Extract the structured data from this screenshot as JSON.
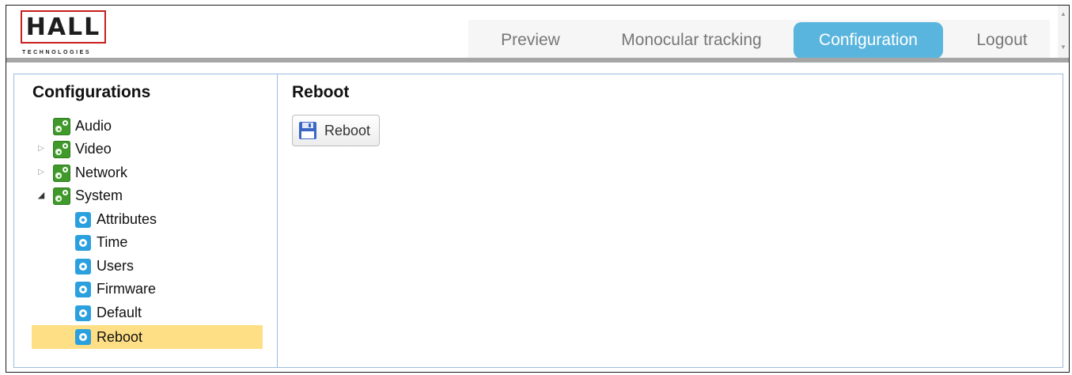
{
  "header": {
    "logo_text": "HALL",
    "logo_subtext": "TECHNOLOGIES",
    "tabs": [
      {
        "label": "Preview",
        "active": false
      },
      {
        "label": "Monocular tracking",
        "active": false
      },
      {
        "label": "Configuration",
        "active": true
      },
      {
        "label": "Logout",
        "active": false
      }
    ]
  },
  "sidebar": {
    "title": "Configurations",
    "items": [
      {
        "label": "Audio",
        "level": 0,
        "icon": "gear-green-icon",
        "expander": "none"
      },
      {
        "label": "Video",
        "level": 0,
        "icon": "gear-green-icon",
        "expander": "collapsed"
      },
      {
        "label": "Network",
        "level": 0,
        "icon": "gear-green-icon",
        "expander": "collapsed"
      },
      {
        "label": "System",
        "level": 0,
        "icon": "gear-green-icon",
        "expander": "expanded"
      },
      {
        "label": "Attributes",
        "level": 1,
        "icon": "gear-blue-icon"
      },
      {
        "label": "Time",
        "level": 1,
        "icon": "gear-blue-icon"
      },
      {
        "label": "Users",
        "level": 1,
        "icon": "gear-blue-icon"
      },
      {
        "label": "Firmware",
        "level": 1,
        "icon": "gear-blue-icon"
      },
      {
        "label": "Default",
        "level": 1,
        "icon": "gear-blue-icon"
      },
      {
        "label": "Reboot",
        "level": 1,
        "icon": "gear-blue-icon",
        "selected": true
      }
    ]
  },
  "main": {
    "title": "Reboot",
    "reboot_button_label": "Reboot"
  },
  "colors": {
    "active_tab": "#5ab5de",
    "selected_item": "#ffdf85",
    "panel_border": "#9bbde0",
    "logo_red": "#c81e1e"
  }
}
